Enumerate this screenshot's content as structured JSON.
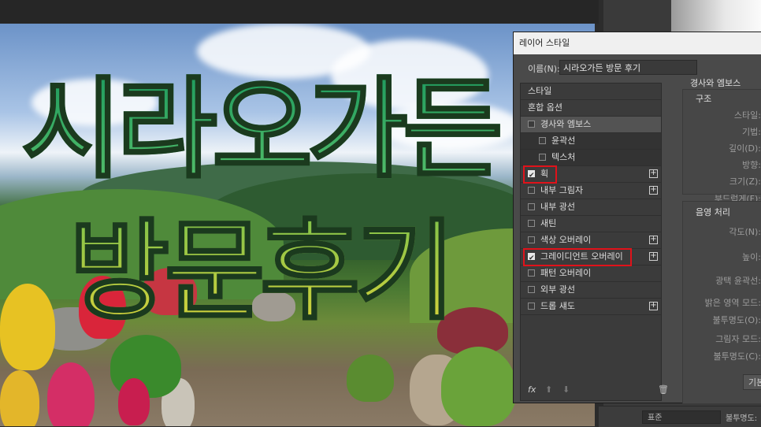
{
  "dialog": {
    "title": "레이어 스타일",
    "name_label": "이름(N):",
    "name_value": "시라오가든 방문 후기"
  },
  "image_text": {
    "line1": "시라오가든",
    "line2": "방문후기"
  },
  "styles_list": [
    {
      "label": "스타일",
      "type": "header"
    },
    {
      "label": "혼합 옵션",
      "type": "header"
    },
    {
      "label": "경사와 엠보스",
      "checked": false,
      "plus": false,
      "selected": true
    },
    {
      "label": "윤곽선",
      "checked": false,
      "plus": false,
      "sub": true
    },
    {
      "label": "텍스처",
      "checked": false,
      "plus": false,
      "sub": true
    },
    {
      "label": "획",
      "checked": true,
      "plus": true,
      "highlight": true
    },
    {
      "label": "내부 그림자",
      "checked": false,
      "plus": true
    },
    {
      "label": "내부 광선",
      "checked": false,
      "plus": false
    },
    {
      "label": "새틴",
      "checked": false,
      "plus": false
    },
    {
      "label": "색상 오버레이",
      "checked": false,
      "plus": true
    },
    {
      "label": "그레이디언트 오버레이",
      "checked": true,
      "plus": true,
      "highlight": true
    },
    {
      "label": "패턴 오버레이",
      "checked": false,
      "plus": false
    },
    {
      "label": "외부 광선",
      "checked": false,
      "plus": false
    },
    {
      "label": "드롭 섀도",
      "checked": false,
      "plus": true
    }
  ],
  "footer_icons": {
    "fx": "fx",
    "up": "arrow-up-icon",
    "down": "arrow-down-icon",
    "trash": "trash-icon"
  },
  "right_panel": {
    "section_title": "경사와 엠보스",
    "structure_title": "구조",
    "structure_fields": [
      "스타일:",
      "기법:",
      "깊이(D):",
      "방향:",
      "크기(Z):",
      "부드럽게(F):"
    ],
    "shading_title": "음영 처리",
    "shading_fields": [
      "각도(N):",
      "높이:",
      "광택 윤곽선:",
      "밝은 영역 모드:",
      "불투명도(O):",
      "그림자 모드:",
      "불투명도(C):"
    ],
    "default_button": "기본값"
  },
  "statusbar": {
    "blend_mode": "표준",
    "opacity_label": "불투명도:"
  },
  "colors": {
    "highlight": "#e0121a",
    "dialog_bg": "#4a4a4a",
    "list_bg": "#3b3b3b"
  }
}
